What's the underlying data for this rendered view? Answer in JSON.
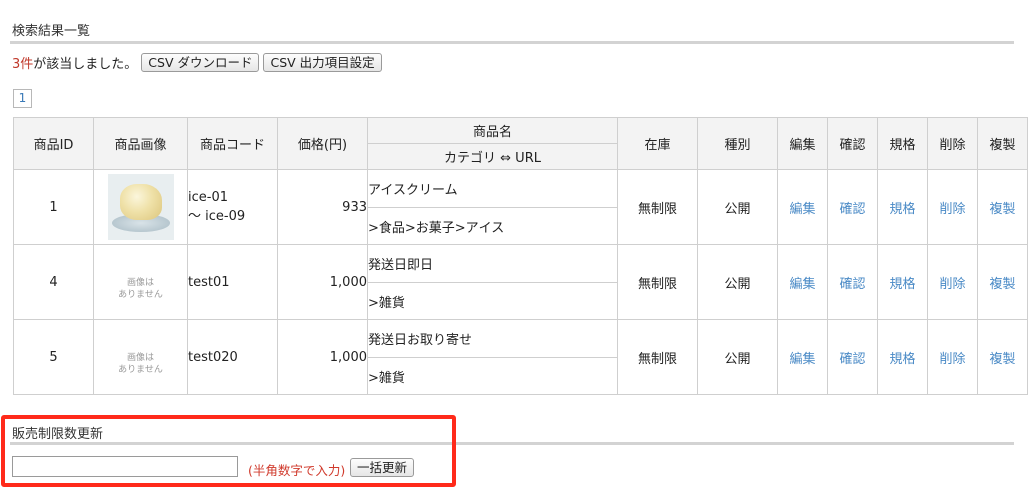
{
  "search_results": {
    "title": "検索結果一覧",
    "count": "3件",
    "count_suffix": " が該当しました。",
    "csv_download_label": "CSV ダウンロード",
    "csv_settings_label": "CSV 出力項目設定",
    "page_number": "1"
  },
  "table": {
    "headers": {
      "id": "商品ID",
      "image": "商品画像",
      "code": "商品コード",
      "price": "価格(円)",
      "name": "商品名",
      "category_url": "カテゴリ ⇔ URL",
      "stock": "在庫",
      "type": "種別",
      "edit": "編集",
      "confirm": "確認",
      "spec": "規格",
      "delete": "削除",
      "copy": "複製"
    },
    "rows": [
      {
        "id": "1",
        "code_line1": "ice-01",
        "code_line2": "〜 ice-09",
        "price": "933",
        "name": "アイスクリーム",
        "category": ">食品>お菓子>アイス",
        "stock": "無制限",
        "type": "公開",
        "edit": "編集",
        "confirm": "確認",
        "spec": "規格",
        "delete": "削除",
        "copy": "複製",
        "image_icon": "ice-cream-photo"
      },
      {
        "id": "4",
        "code_line1": "test01",
        "code_line2": "",
        "price": "1,000",
        "name": "発送日即日",
        "category": ">雑貨",
        "stock": "無制限",
        "type": "公開",
        "edit": "編集",
        "confirm": "確認",
        "spec": "規格",
        "delete": "削除",
        "copy": "複製",
        "no_image_line1": "画像は",
        "no_image_line2": "ありません"
      },
      {
        "id": "5",
        "code_line1": "test020",
        "code_line2": "",
        "price": "1,000",
        "name": "発送日お取り寄せ",
        "category": ">雑貨",
        "stock": "無制限",
        "type": "公開",
        "edit": "編集",
        "confirm": "確認",
        "spec": "規格",
        "delete": "削除",
        "copy": "複製",
        "no_image_line1": "画像は",
        "no_image_line2": "ありません"
      }
    ]
  },
  "sales_limit": {
    "title": "販売制限数更新",
    "input_value": "",
    "hint": "(半角数字で入力)",
    "bulk_update_label": "一括更新"
  },
  "colors": {
    "accent_link": "#4a8ac6",
    "count_red": "#c0392b",
    "highlight_red": "#ff2a1a"
  }
}
